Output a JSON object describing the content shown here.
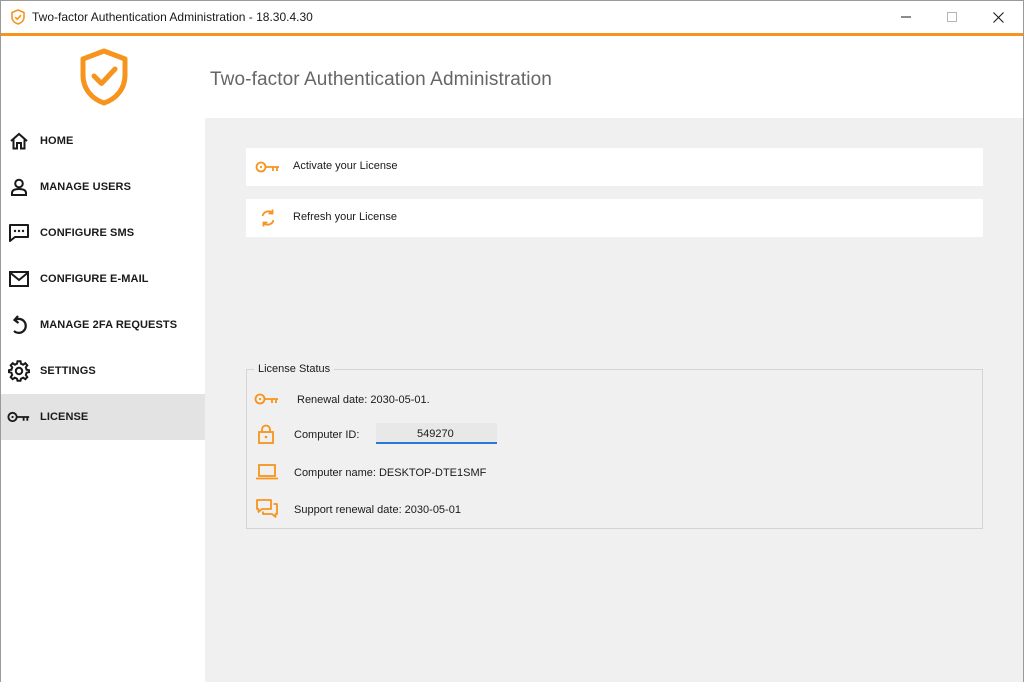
{
  "window": {
    "title": "Two-factor Authentication Administration - 18.30.4.30"
  },
  "header": {
    "heading": "Two-factor Authentication Administration"
  },
  "colors": {
    "accent": "#f7941d",
    "active_nav_bg": "#e3e3e3",
    "content_bg": "#f0f0f0",
    "input_underline": "#2b79d4"
  },
  "sidebar": {
    "items": [
      {
        "label": "HOME",
        "icon": "home-icon"
      },
      {
        "label": "MANAGE USERS",
        "icon": "user-icon"
      },
      {
        "label": "CONFIGURE SMS",
        "icon": "sms-icon"
      },
      {
        "label": "CONFIGURE E-MAIL",
        "icon": "mail-icon"
      },
      {
        "label": "MANAGE 2FA REQUESTS",
        "icon": "undo-arrow-icon"
      },
      {
        "label": "SETTINGS",
        "icon": "gear-icon"
      },
      {
        "label": "LICENSE",
        "icon": "key-icon",
        "active": true
      }
    ]
  },
  "actions": {
    "activate_label": "Activate your License",
    "refresh_label": "Refresh your License"
  },
  "license_status": {
    "legend": "License Status",
    "renewal_text": "Renewal date: 2030-05-01.",
    "computer_id_label": "Computer ID:",
    "computer_id_value": "549270",
    "computer_name_text": "Computer name: DESKTOP-DTE1SMF",
    "support_renewal_text": "Support renewal date: 2030-05-01"
  }
}
